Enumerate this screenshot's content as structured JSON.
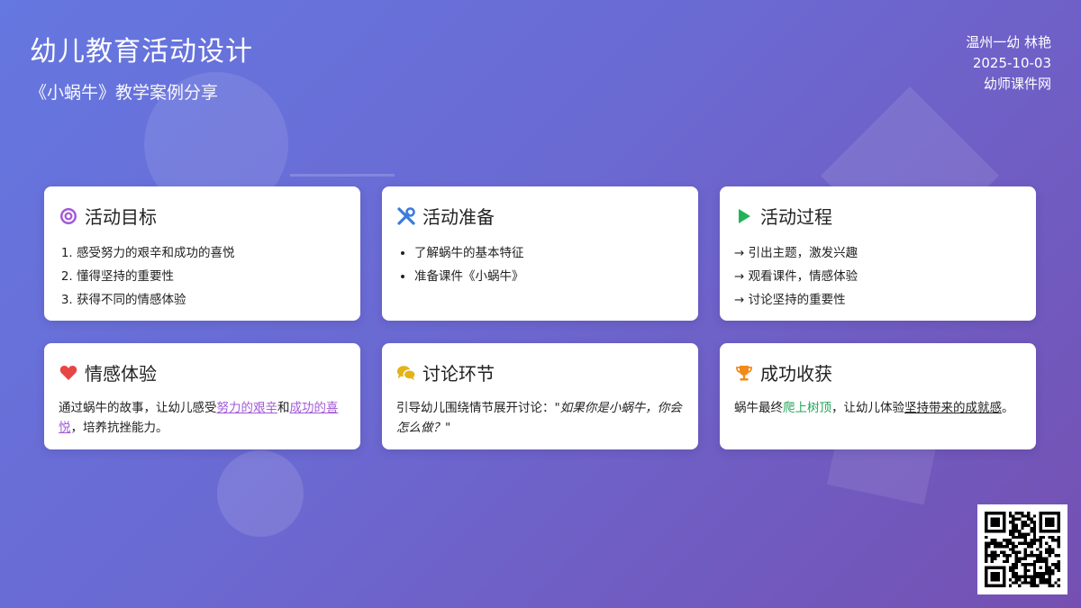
{
  "header": {
    "title": "幼儿教育活动设计",
    "subtitle": "《小蜗牛》教学案例分享",
    "author": "温州一幼 林艳",
    "date": "2025-10-03",
    "source": "幼师课件网"
  },
  "cards": {
    "goals": {
      "title": "活动目标",
      "icon": "target-icon",
      "items": [
        "感受努力的艰辛和成功的喜悦",
        "懂得坚持的重要性",
        "获得不同的情感体验"
      ]
    },
    "prep": {
      "title": "活动准备",
      "icon": "tools-icon",
      "items": [
        "了解蜗牛的基本特征",
        "准备课件《小蜗牛》"
      ]
    },
    "process": {
      "title": "活动过程",
      "icon": "play-icon",
      "items": [
        "→ 引出主题，激发兴趣",
        "→ 观看课件，情感体验",
        "→ 讨论坚持的重要性"
      ]
    },
    "emotion": {
      "title": "情感体验",
      "icon": "heart-icon",
      "text_1": "通过蜗牛的故事，让幼儿感受",
      "hl_1": "努力的艰辛",
      "text_2": "和",
      "hl_2": "成功的喜悦",
      "text_3": "，培养抗挫能力。"
    },
    "discussion": {
      "title": "讨论环节",
      "icon": "chat-icon",
      "text_1": "引导幼儿围绕情节展开讨论：\"",
      "quote": "如果你是小蜗牛，你会怎么做？",
      "text_2": "\""
    },
    "harvest": {
      "title": "成功收获",
      "icon": "trophy-icon",
      "text_1": "蜗牛最终",
      "hl_1": "爬上树顶",
      "text_2": "，让幼儿体验",
      "hl_2": "坚持带来的成就感",
      "text_3": "。"
    }
  },
  "colors": {
    "accent_purple": "#a25ad8",
    "accent_green": "#22a559",
    "icon_blue": "#3a7bdc",
    "icon_red": "#e84545",
    "icon_yellow": "#e2b418",
    "icon_orange": "#f08a1a"
  }
}
